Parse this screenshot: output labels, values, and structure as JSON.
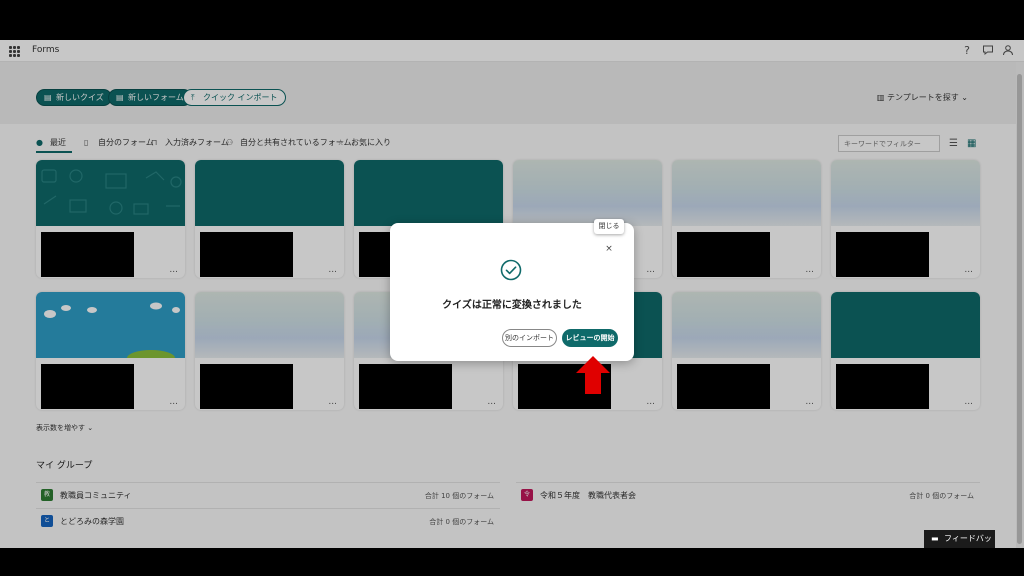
{
  "app": {
    "title": "Forms"
  },
  "topbar": {
    "help_icon": "?",
    "chat_icon": "chat-icon",
    "avatar_icon": "person-icon"
  },
  "header": {
    "new_quiz": "新しいクイズ",
    "new_form": "新しいフォーム",
    "quick_import": "クイック インポート",
    "templates": "テンプレートを探す"
  },
  "tabs": [
    {
      "label": "最近"
    },
    {
      "label": "自分のフォーム"
    },
    {
      "label": "入力済みフォーム"
    },
    {
      "label": "自分と共有されているフォーム"
    },
    {
      "label": "お気に入り"
    }
  ],
  "filter": {
    "placeholder": "キーワードでフィルター"
  },
  "cards": {
    "more_label": "..."
  },
  "show_more": "表示数を増やす",
  "groups": {
    "title": "マイ グループ",
    "items": [
      {
        "name": "教職員コミュニティ",
        "count": "合計 10 個のフォーム",
        "color": "#2e7d32"
      },
      {
        "name": "令和５年度　教職代表者会",
        "count": "合計 0 個のフォーム",
        "color": "#c2185b"
      },
      {
        "name": "とどろみの森学園",
        "count": "合計 0 個のフォーム",
        "color": "#1565c0"
      }
    ]
  },
  "feedback": "フィードバック",
  "dialog": {
    "close_tooltip": "閉じる",
    "close_symbol": "×",
    "message": "クイズは正常に変換されました",
    "other_import": "別のインポート",
    "start_review": "レビューの開始"
  },
  "colors": {
    "accent": "#0f6a6a",
    "arrow": "#e00000"
  }
}
